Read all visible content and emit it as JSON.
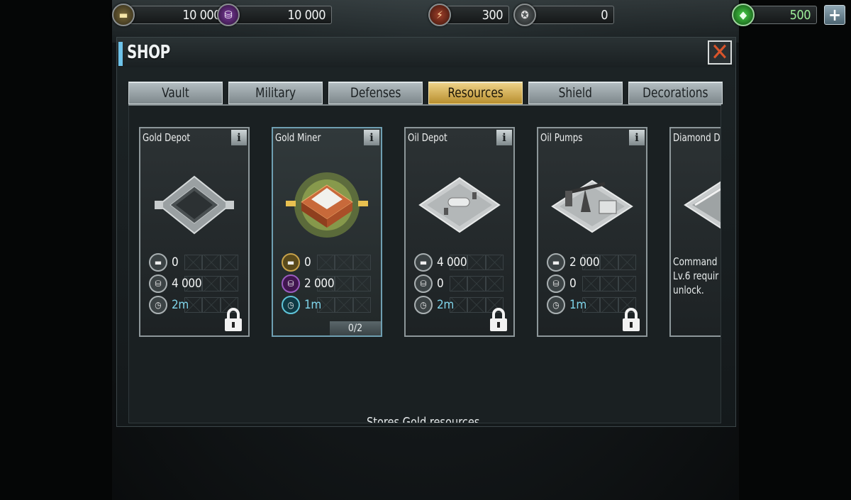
{
  "topbar": {
    "gold": {
      "icon": "gold-bars-icon",
      "value": "10 000"
    },
    "oil": {
      "icon": "oil-barrel-icon",
      "value": "10 000"
    },
    "energy": {
      "icon": "lightning-icon",
      "value": "300"
    },
    "medals": {
      "icon": "medal-icon",
      "value": "0"
    },
    "gems": {
      "icon": "green-gem-icon",
      "value": "500"
    },
    "plus_label": "+"
  },
  "shop": {
    "title": "SHOP",
    "close_label": "✕",
    "tabs": [
      {
        "label": "Vault",
        "active": false
      },
      {
        "label": "Military",
        "active": false
      },
      {
        "label": "Defenses",
        "active": false
      },
      {
        "label": "Resources",
        "active": true
      },
      {
        "label": "Shield",
        "active": false
      },
      {
        "label": "Decorations",
        "active": false
      }
    ],
    "cards": [
      {
        "name": "Gold Depot",
        "gold": "0",
        "oil": "4 000",
        "time": "2m",
        "locked": true
      },
      {
        "name": "Gold Miner",
        "gold": "0",
        "oil": "2 000",
        "time": "1m",
        "locked": false,
        "count": "0/2"
      },
      {
        "name": "Oil Depot",
        "gold": "4 000",
        "oil": "0",
        "time": "2m",
        "locked": true
      },
      {
        "name": "Oil Pumps",
        "gold": "2 000",
        "oil": "0",
        "time": "1m",
        "locked": true
      },
      {
        "name": "Diamond D",
        "requirement": "Command\nLv.6 requir\nunlock."
      }
    ],
    "info_label": "i",
    "description": "Stores Gold resources."
  }
}
